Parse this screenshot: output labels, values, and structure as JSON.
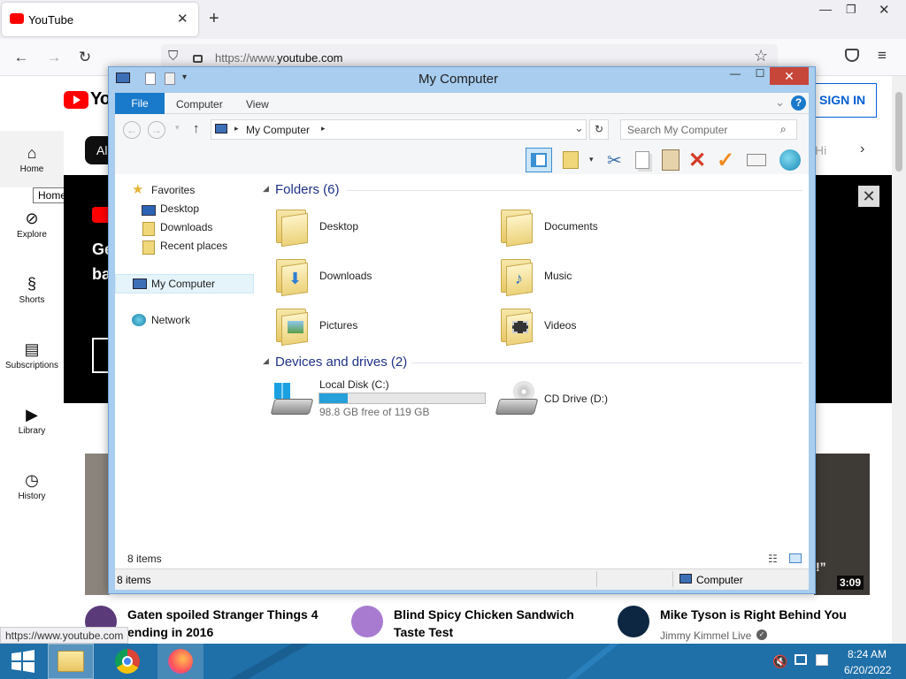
{
  "browser": {
    "tab_title": "YouTube",
    "url_prefix": "https://www.",
    "url_domain": "youtube.com",
    "status_url": "https://www.youtube.com"
  },
  "youtube": {
    "logo": "You",
    "sign_in": "SIGN IN",
    "chip_all": "All",
    "chip_right": "Hi",
    "tooltip": "Home",
    "nav": [
      "Home",
      "Explore",
      "Shorts",
      "Subscriptions",
      "Library",
      "History"
    ],
    "banner_lines": [
      "Ge",
      "ba"
    ],
    "videos": [
      {
        "title_1": "Gaten spoiled Stranger Things 4",
        "title_2": "ending in 2016",
        "channel": ""
      },
      {
        "title_1": "Blind Spicy Chicken Sandwich",
        "title_2": "Taste Test",
        "channel": ""
      },
      {
        "title_1": "Mike Tyson is Right Behind You",
        "title_2": "",
        "channel": "Jimmy Kimmel Live"
      }
    ],
    "duration": "3:09",
    "quote_mark": "!”"
  },
  "explorer": {
    "title": "My Computer",
    "tabs": [
      "File",
      "Computer",
      "View"
    ],
    "address": "My Computer",
    "search_placeholder": "Search My Computer",
    "nav": {
      "favorites": "Favorites",
      "fav_items": [
        "Desktop",
        "Downloads",
        "Recent places"
      ],
      "my_computer": "My Computer",
      "network": "Network"
    },
    "groups": {
      "folders": "Folders (6)",
      "devices": "Devices and drives (2)"
    },
    "folders": [
      "Desktop",
      "Documents",
      "Downloads",
      "Music",
      "Pictures",
      "Videos"
    ],
    "drives": [
      {
        "name": "Local Disk (C:)",
        "free": "98.8 GB free of 119 GB",
        "used_fraction": 0.17
      },
      {
        "name": "CD Drive (D:)"
      }
    ],
    "item_count": "8 items",
    "status_items": "8 items",
    "status_location": "Computer"
  },
  "taskbar": {
    "time": "8:24 AM",
    "date": "6/20/2022"
  },
  "colors": {
    "accent": "#1979ca",
    "yt_red": "#ff0000",
    "taskbar": "#1f6fa8",
    "window_frame": "#a8cdee"
  }
}
